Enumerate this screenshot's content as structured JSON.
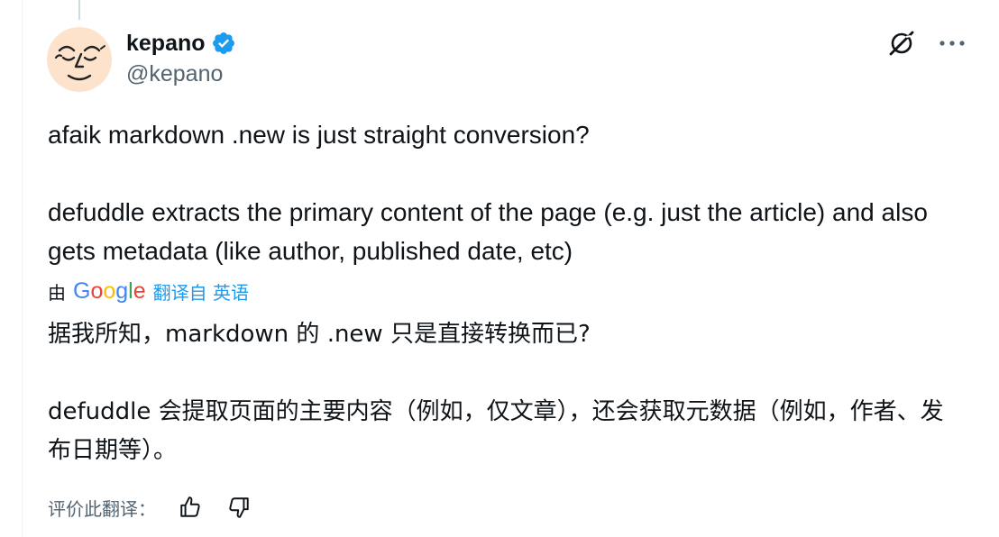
{
  "thread": {
    "author": {
      "display_name": "kepano",
      "handle": "@kepano",
      "verified": true
    },
    "tweet": {
      "text": "afaik markdown .new is just straight conversion?\n\ndefuddle extracts the primary content of the page (e.g. just the article) and also gets metadata (like author, published date, etc)"
    },
    "translation": {
      "by_label": "由",
      "provider": "Google",
      "link_label": "翻译自 英语",
      "text": "据我所知，markdown 的 .new 只是直接转换而已?\n\ndefuddle 会提取页面的主要内容（例如，仅文章），还会获取元数据（例如，作者、发布日期等）。"
    },
    "rating": {
      "label": "评价此翻译："
    }
  },
  "icons": {
    "verified": "verified-badge-icon",
    "grok": "grok-icon",
    "more": "more-icon",
    "thumbs_up": "thumbs-up-icon",
    "thumbs_down": "thumbs-down-icon"
  },
  "colors": {
    "text": "#0f1419",
    "secondary": "#536471",
    "accent": "#1d9bf0",
    "avatar_bg": "#fde2cc"
  }
}
